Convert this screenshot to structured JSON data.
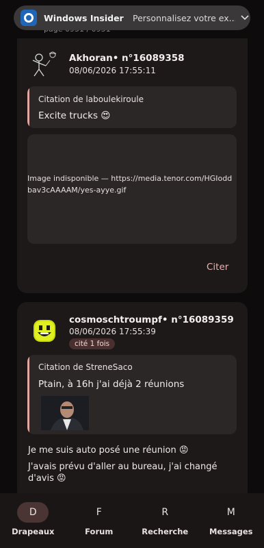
{
  "notification": {
    "app_title": "Windows Insider P...",
    "text": "Personnalisez votre ex...",
    "icon": "windows-insider-icon"
  },
  "page_indicator": "page 0951 / 0951",
  "posts": [
    {
      "author": "Akhoran",
      "post_number": "• n°16089358",
      "date": "08/06/2026 17:55:11",
      "quote": {
        "label": "Citation de laboulekiroule",
        "text": "Excite trucks 😍"
      },
      "image_unavailable": "Image indisponible — https://media.tenor.com/HGIoddbav3cAAAAM/yes-ayye.gif",
      "cite_label": "Citer"
    },
    {
      "author": "cosmoschtroumpf",
      "post_number": "• n°16089359",
      "date": "08/06/2026 17:55:39",
      "badge": "cité 1 fois",
      "quote": {
        "label": "Citation de StreneSaco",
        "text": "Ptain, à 16h j'ai déjà 2 réunions"
      },
      "body": [
        "Je me suis auto posé une réunion 😡",
        "J'avais prévu d'aller au bureau, j'ai changé",
        "d'avis 😡"
      ]
    }
  ],
  "nav": [
    {
      "glyph": "D",
      "label": "Drapeaux",
      "active": true
    },
    {
      "glyph": "F",
      "label": "Forum",
      "active": false
    },
    {
      "glyph": "R",
      "label": "Recherche",
      "active": false
    },
    {
      "glyph": "M",
      "label": "Messages",
      "active": false
    }
  ],
  "colors": {
    "background": "#0d0b0b",
    "card": "#1d1919",
    "quote_bg": "#2c2727",
    "accent": "#f0b2ad",
    "quote_bar": "#e2a7a3",
    "nav_active": "#4a3534"
  }
}
